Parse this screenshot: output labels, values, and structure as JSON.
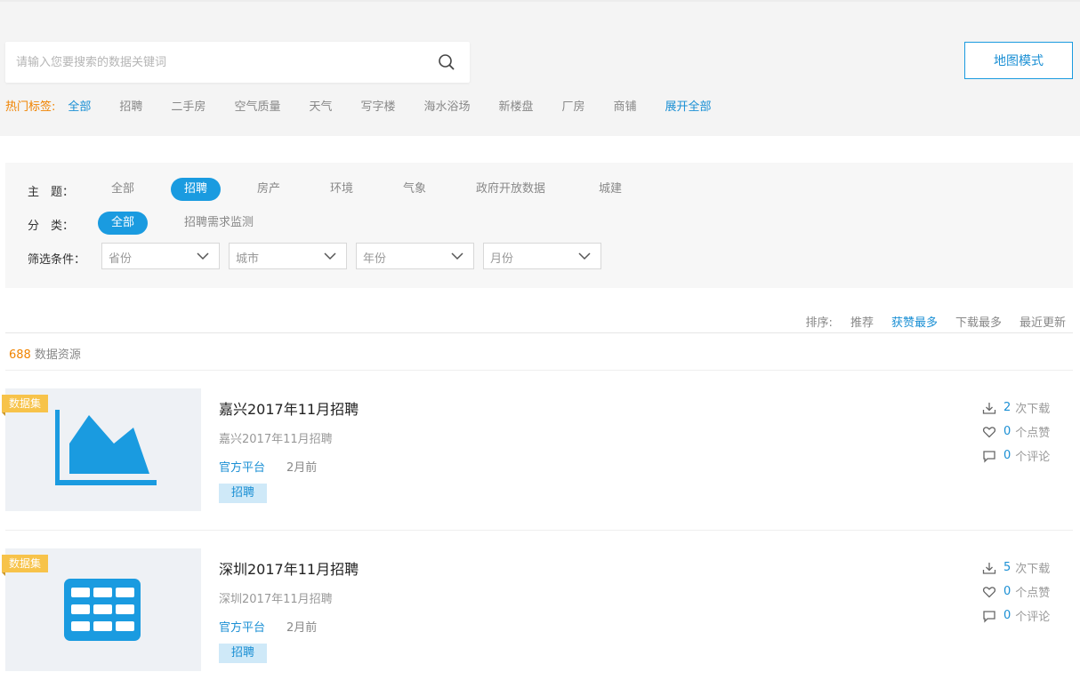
{
  "search": {
    "placeholder": "请输入您要搜索的数据关键词"
  },
  "map_mode_label": "地图模式",
  "hot_tags": {
    "label": "热门标签:",
    "items": [
      "全部",
      "招聘",
      "二手房",
      "空气质量",
      "天气",
      "写字楼",
      "海水浴场",
      "新楼盘",
      "厂房",
      "商铺"
    ],
    "active_index": 0,
    "expand_label": "展开全部"
  },
  "filters": {
    "topic_label": "主　题：",
    "topics": [
      "全部",
      "招聘",
      "房产",
      "环境",
      "气象",
      "政府开放数据",
      "城建"
    ],
    "topic_active": 1,
    "category_label": "分　类：",
    "categories": [
      "全部",
      "招聘需求监测"
    ],
    "category_active": 0,
    "condition_label": "筛选条件：",
    "selects": [
      "省份",
      "城市",
      "年份",
      "月份"
    ]
  },
  "sort": {
    "label": "排序:",
    "options": [
      "推荐",
      "获赞最多",
      "下载最多",
      "最近更新"
    ],
    "active_index": 1
  },
  "result_count": {
    "number": "688",
    "label": "数据资源"
  },
  "colors": {
    "accent": "#1a9be0",
    "orange": "#f08300",
    "ribbon": "#f7c34a"
  },
  "cards": [
    {
      "ribbon": "数据集",
      "icon": "area-chart-icon",
      "title": "嘉兴2017年11月招聘",
      "subtitle": "嘉兴2017年11月招聘",
      "source": "官方平台",
      "time": "2月前",
      "tag": "招聘",
      "downloads": "2",
      "downloads_label": "次下载",
      "likes": "0",
      "likes_label": "个点赞",
      "comments": "0",
      "comments_label": "个评论"
    },
    {
      "ribbon": "数据集",
      "icon": "table-grid-icon",
      "title": "深圳2017年11月招聘",
      "subtitle": "深圳2017年11月招聘",
      "source": "官方平台",
      "time": "2月前",
      "tag": "招聘",
      "downloads": "5",
      "downloads_label": "次下载",
      "likes": "0",
      "likes_label": "个点赞",
      "comments": "0",
      "comments_label": "个评论"
    }
  ]
}
